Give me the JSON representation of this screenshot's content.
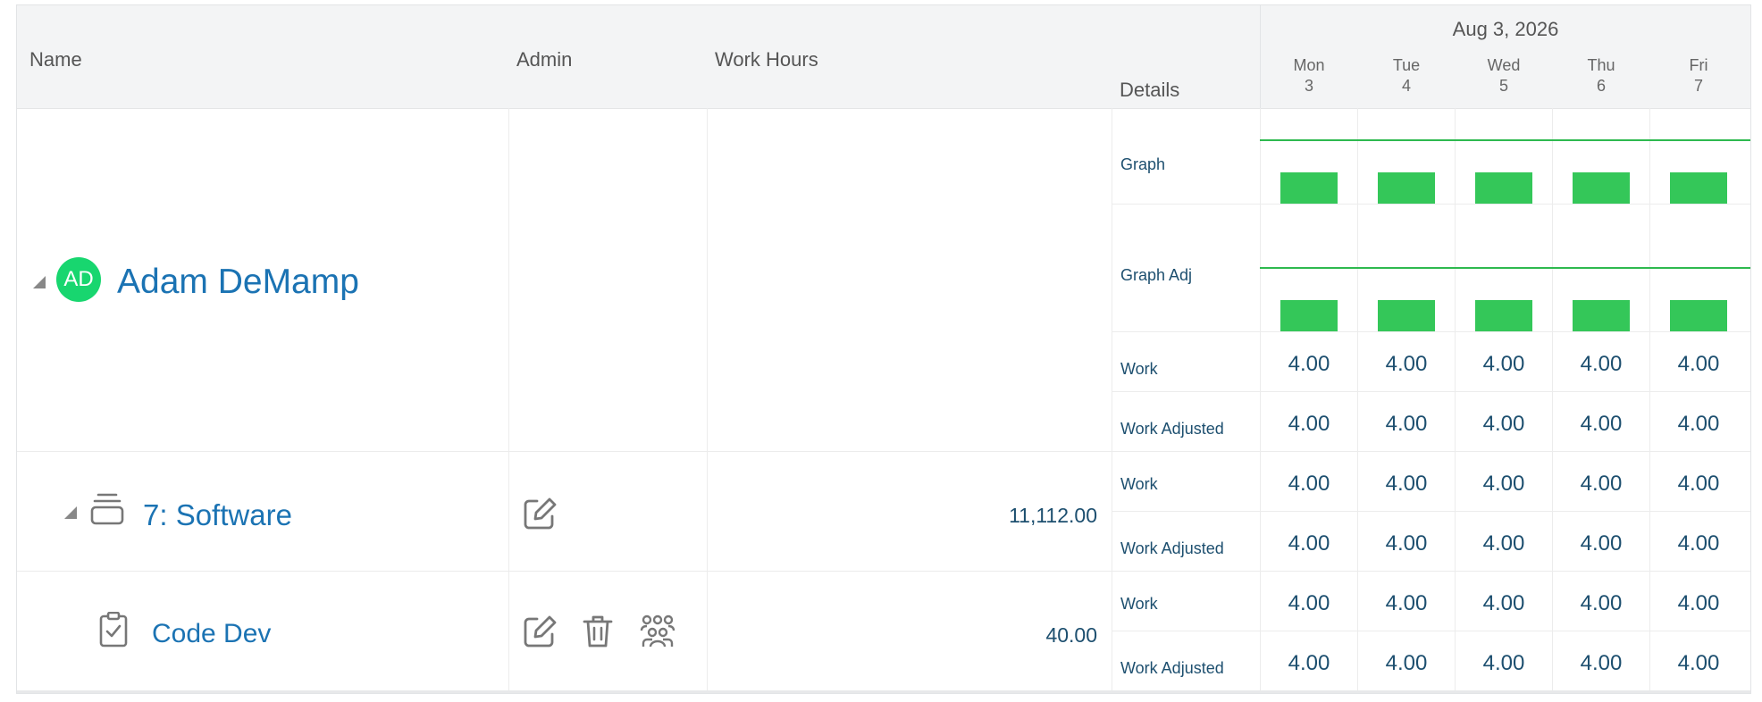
{
  "header": {
    "name": "Name",
    "admin": "Admin",
    "work_hours": "Work Hours",
    "details": "Details",
    "week_date": "Aug 3, 2026",
    "days": [
      {
        "dow": "Mon",
        "dom": "3"
      },
      {
        "dow": "Tue",
        "dom": "4"
      },
      {
        "dow": "Wed",
        "dom": "5"
      },
      {
        "dow": "Thu",
        "dom": "6"
      },
      {
        "dow": "Fri",
        "dom": "7"
      }
    ]
  },
  "user": {
    "initials": "AD",
    "name": "Adam DeMamp",
    "avatar_color": "#18d66f",
    "rows": [
      {
        "label": "Graph",
        "values": []
      },
      {
        "label": "Graph Adj",
        "values": []
      },
      {
        "label": "Work",
        "values": [
          "4.00",
          "4.00",
          "4.00",
          "4.00",
          "4.00"
        ]
      },
      {
        "label": "Work Adjusted",
        "values": [
          "4.00",
          "4.00",
          "4.00",
          "4.00",
          "4.00"
        ]
      }
    ]
  },
  "project": {
    "name": "7: Software",
    "work_hours": "11,112.00",
    "icon": "stack-icon",
    "rows": [
      {
        "label": "Work",
        "values": [
          "4.00",
          "4.00",
          "4.00",
          "4.00",
          "4.00"
        ]
      },
      {
        "label": "Work Adjusted",
        "values": [
          "4.00",
          "4.00",
          "4.00",
          "4.00",
          "4.00"
        ]
      }
    ]
  },
  "task": {
    "name": "Code Dev",
    "work_hours": "40.00",
    "icon": "clipboard-check-icon",
    "rows": [
      {
        "label": "Work",
        "values": [
          "4.00",
          "4.00",
          "4.00",
          "4.00",
          "4.00"
        ]
      },
      {
        "label": "Work Adjusted",
        "values": [
          "4.00",
          "4.00",
          "4.00",
          "4.00",
          "4.00"
        ]
      }
    ]
  },
  "colors": {
    "accent_link": "#1b73b3",
    "graph_green": "#34c759",
    "value_text": "#1d4f6f"
  }
}
